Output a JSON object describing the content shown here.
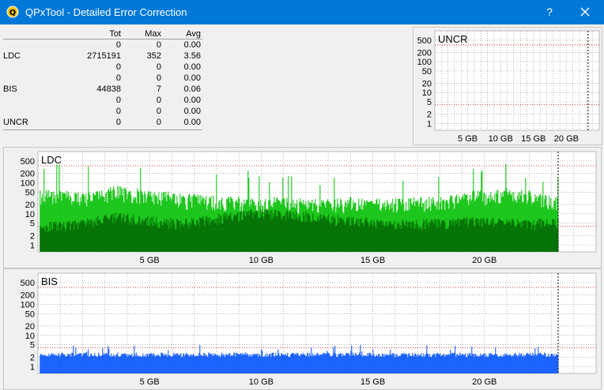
{
  "window": {
    "title": "QPxTool - Detailed Error Correction",
    "help_label": "?",
    "titlebar_color": "#0078d7"
  },
  "stats": {
    "headers": [
      "",
      "Tot",
      "Max",
      "Avg"
    ],
    "rows": [
      [
        "",
        "0",
        "0",
        "0.00"
      ],
      [
        "LDC",
        "2715191",
        "352",
        "3.56"
      ],
      [
        "",
        "0",
        "0",
        "0.00"
      ],
      [
        "",
        "0",
        "0",
        "0.00"
      ],
      [
        "BIS",
        "44838",
        "7",
        "0.06"
      ],
      [
        "",
        "0",
        "0",
        "0.00"
      ],
      [
        "",
        "0",
        "0",
        "0.00"
      ],
      [
        "UNCR",
        "0",
        "0",
        "0.00"
      ]
    ]
  },
  "chart_data": [
    {
      "type": "bar",
      "title": "UNCR",
      "ylog": true,
      "yticks": [
        "500",
        "200",
        "100",
        "50",
        "20",
        "10",
        "5",
        "2",
        "1"
      ],
      "ytick_values": [
        500,
        200,
        100,
        50,
        20,
        10,
        5,
        2,
        1
      ],
      "xticks": [
        "5 GB",
        "10 GB",
        "15 GB",
        "20 GB"
      ],
      "xtick_values": [
        5,
        10,
        15,
        20
      ],
      "xlim": [
        0,
        25
      ],
      "end_marker_gb": 23.3,
      "red_lines": [
        350,
        4
      ],
      "series": [
        {
          "values": []
        }
      ]
    },
    {
      "type": "bar",
      "title": "LDC",
      "ylog": true,
      "yticks": [
        "500",
        "200",
        "100",
        "50",
        "20",
        "10",
        "5",
        "2",
        "1"
      ],
      "ytick_values": [
        500,
        200,
        100,
        50,
        20,
        10,
        5,
        2,
        1
      ],
      "xticks": [
        "5 GB",
        "10 GB",
        "15 GB",
        "20 GB"
      ],
      "xtick_values": [
        5,
        10,
        15,
        20
      ],
      "xlim": [
        0,
        25
      ],
      "end_marker_gb": 23.3,
      "red_lines": [
        350,
        4
      ],
      "colors": {
        "peak": "#00c000",
        "base": "#006000",
        "fill": "#00c000"
      },
      "x_gb": [
        0.5,
        2,
        3.5,
        5,
        6.5,
        8,
        9.5,
        11,
        12.5,
        14,
        15.5,
        17,
        18.5,
        20,
        21.5,
        23
      ],
      "peak": [
        60,
        50,
        80,
        60,
        45,
        40,
        35,
        35,
        30,
        35,
        30,
        35,
        40,
        60,
        70,
        35
      ],
      "avg": [
        4,
        5,
        8,
        6,
        5,
        7,
        10,
        10,
        8,
        6,
        5,
        5,
        5,
        6,
        5,
        5
      ]
    },
    {
      "type": "bar",
      "title": "BIS",
      "ylog": true,
      "yticks": [
        "500",
        "200",
        "100",
        "50",
        "20",
        "10",
        "5",
        "2",
        "1"
      ],
      "ytick_values": [
        500,
        200,
        100,
        50,
        20,
        10,
        5,
        2,
        1
      ],
      "xticks": [
        "5 GB",
        "10 GB",
        "15 GB",
        "20 GB"
      ],
      "xtick_values": [
        5,
        10,
        15,
        20
      ],
      "xlim": [
        0,
        25
      ],
      "end_marker_gb": 23.3,
      "red_lines": [
        350,
        4
      ],
      "colors": {
        "bar": "#0050ff",
        "dark": "#0018a0"
      },
      "x_gb": [
        0.5,
        2,
        3.5,
        5,
        6.5,
        8,
        9.5,
        11,
        12.5,
        14,
        15.5,
        17,
        18.5,
        20,
        21.5,
        23
      ],
      "peak": [
        3,
        3,
        3,
        3,
        3,
        3,
        2,
        2,
        3,
        3,
        3,
        3,
        3,
        3,
        3,
        3
      ],
      "avg": [
        2,
        2,
        2,
        2,
        2,
        2,
        2,
        2,
        2,
        2,
        2,
        2,
        2,
        2,
        2,
        2
      ]
    }
  ]
}
